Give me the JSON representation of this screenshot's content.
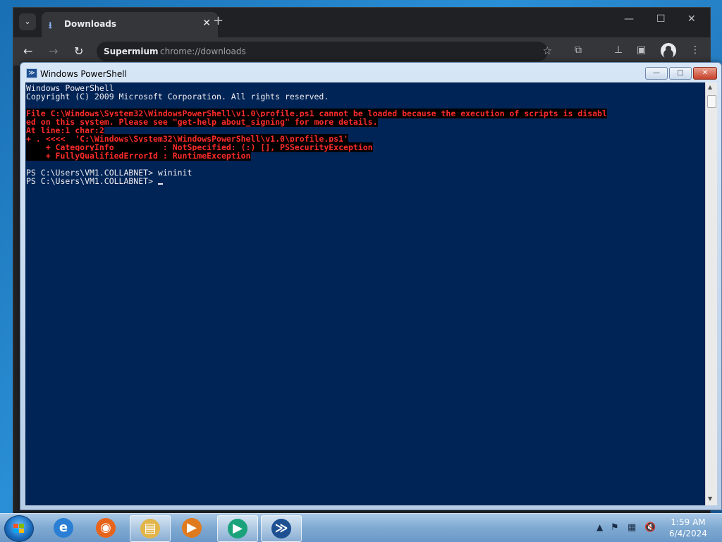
{
  "browser": {
    "tab": {
      "icon": "download-icon",
      "title": "Downloads"
    },
    "toolbar": {
      "site_chip": "Supermium",
      "url": "chrome://downloads"
    }
  },
  "powershell": {
    "title": "Windows PowerShell",
    "buttons": {
      "minimize": "—",
      "maximize": "□",
      "close": "✕"
    },
    "console_lines": [
      {
        "kind": "normal",
        "text": "Windows PowerShell"
      },
      {
        "kind": "normal",
        "text": "Copyright (C) 2009 Microsoft Corporation. All rights reserved."
      },
      {
        "kind": "blank",
        "text": ""
      },
      {
        "kind": "error",
        "text": "File C:\\Windows\\System32\\WindowsPowerShell\\v1.0\\profile.ps1 cannot be loaded because the execution of scripts is disabl"
      },
      {
        "kind": "error",
        "text": "ed on this system. Please see \"get-help about_signing\" for more details."
      },
      {
        "kind": "error",
        "text": "At line:1 char:2"
      },
      {
        "kind": "error",
        "text": "+ . <<<<  'C:\\Windows\\System32\\WindowsPowerShell\\v1.0\\profile.ps1'"
      },
      {
        "kind": "error",
        "text": "    + CategoryInfo          : NotSpecified: (:) [], PSSecurityException"
      },
      {
        "kind": "error",
        "text": "    + FullyQualifiedErrorId : RuntimeException"
      },
      {
        "kind": "blank",
        "text": ""
      },
      {
        "kind": "normal",
        "text": "PS C:\\Users\\VM1.COLLABNET> wininit"
      },
      {
        "kind": "prompt",
        "text": "PS C:\\Users\\VM1.COLLABNET> "
      }
    ]
  },
  "taskbar": {
    "apps": [
      {
        "name": "taskbar-internet-explorer",
        "icon": "internet-explorer-icon",
        "glyph": "e",
        "color": "#2a7fd4",
        "active": false
      },
      {
        "name": "taskbar-firefox",
        "icon": "firefox-icon",
        "glyph": "◉",
        "color": "#e8641b",
        "active": false
      },
      {
        "name": "taskbar-file-explorer",
        "icon": "folder-icon",
        "glyph": "▤",
        "color": "#e2b54a",
        "active": true
      },
      {
        "name": "taskbar-media-player",
        "icon": "media-player-icon",
        "glyph": "▶",
        "color": "#e07a1e",
        "active": false
      },
      {
        "name": "taskbar-chrome-app",
        "icon": "supermium-icon",
        "glyph": "▶",
        "color": "#1aa37a",
        "active": true
      },
      {
        "name": "taskbar-powershell",
        "icon": "powershell-icon",
        "glyph": "≫",
        "color": "#1d4f91",
        "active": true
      }
    ],
    "clock": {
      "time": "1:59 AM",
      "date": "6/4/2024"
    }
  }
}
